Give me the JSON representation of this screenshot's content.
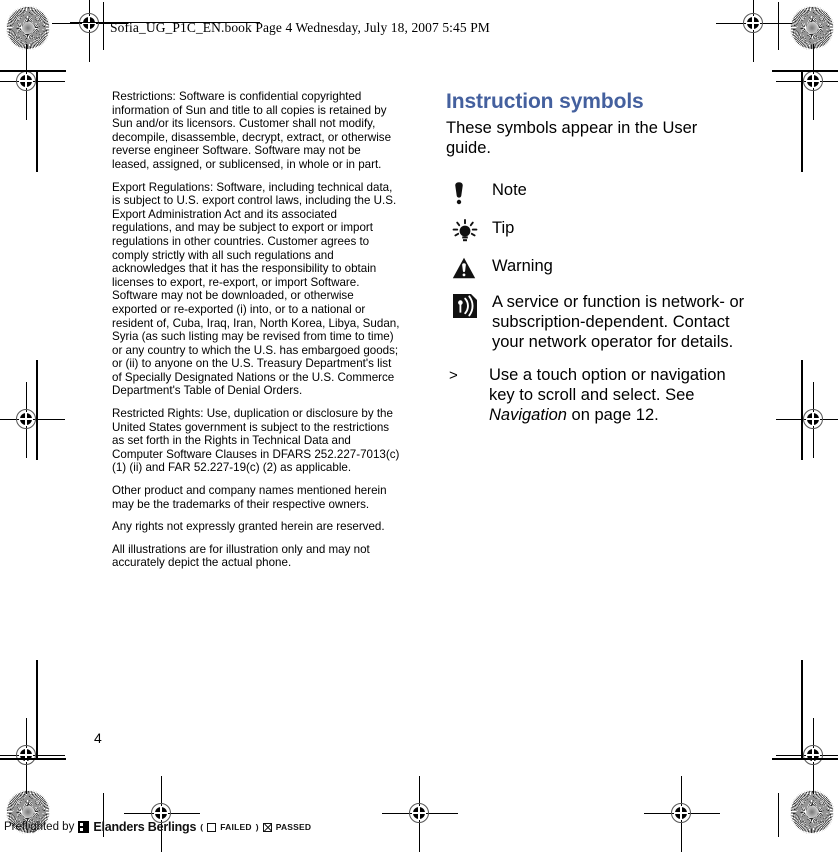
{
  "header": {
    "slug": "Sofia_UG_P1C_EN.book  Page 4  Wednesday, July 18, 2007  5:45 PM"
  },
  "left_column": {
    "paragraphs": [
      "Restrictions: Software is confidential copyrighted information of Sun and title to all copies is retained by Sun and/or its licensors. Customer shall not modify, decompile, disassemble, decrypt, extract, or otherwise reverse engineer Software. Software may not be leased, assigned, or sublicensed, in whole or in part.",
      "Export Regulations: Software, including technical data, is subject to U.S. export control laws, including the U.S. Export Administration Act and its associated regulations, and may be subject to export or import regulations in other countries. Customer agrees to comply strictly with all such regulations and acknowledges that it has the responsibility to obtain licenses to export, re-export, or import Software. Software may not be downloaded, or otherwise exported or re-exported (i) into, or to a national or resident of, Cuba, Iraq, Iran, North Korea, Libya, Sudan, Syria (as such listing may be revised from time to time) or any country to which the U.S. has embargoed goods; or (ii) to anyone on the U.S. Treasury Department's list of Specially Designated Nations or the U.S. Commerce Department's Table of Denial Orders.",
      "Restricted Rights: Use, duplication or disclosure by the United States government is subject to the restrictions as set forth in the Rights in Technical Data and Computer Software Clauses in DFARS 252.227-7013(c) (1) (ii) and FAR 52.227-19(c) (2) as applicable.",
      "Other product and company names mentioned herein may be the trademarks of their respective owners.",
      "Any rights not expressly granted herein are reserved.",
      "All illustrations are for illustration only and may not accurately depict the actual phone."
    ]
  },
  "right_column": {
    "heading": "Instruction symbols",
    "heading_color": "#44609e",
    "intro": "These symbols appear in the User guide.",
    "symbols": [
      {
        "icon": "exclamation-note-icon",
        "label": "Note"
      },
      {
        "icon": "lightbulb-tip-icon",
        "label": "Tip"
      },
      {
        "icon": "warning-triangle-icon",
        "label": "Warning"
      },
      {
        "icon": "network-signal-icon",
        "label": "A service or function is network- or subscription-dependent. Contact your network operator for details."
      },
      {
        "icon": "greater-than-marker",
        "marker": ">",
        "label_parts": {
          "before": "Use a touch option or navigation key to scroll and select. See ",
          "italic": "Navigation",
          "after": " on page 12."
        }
      }
    ]
  },
  "folio": {
    "page_number": "4"
  },
  "footer": {
    "preflight_label": "Preflighted by",
    "brand": "Elanders Berlings",
    "open_paren": "(",
    "failed_label": "FAILED",
    "close_paren": ")",
    "passed_label": "PASSED"
  }
}
